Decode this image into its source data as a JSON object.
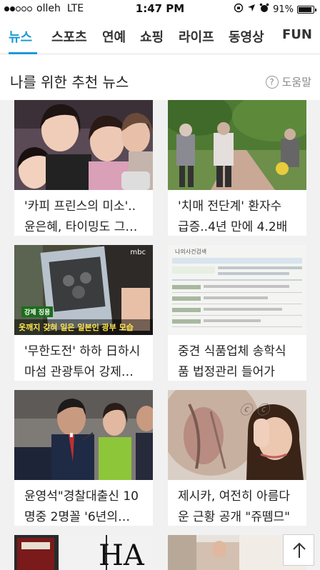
{
  "status_bar": {
    "carrier": "olleh",
    "network": "LTE",
    "time": "1:47 PM",
    "battery": "91%",
    "battery_level": 0.91,
    "signal_bars": 2,
    "signal_total": 5
  },
  "tabs": [
    {
      "label": "뉴스",
      "active": true
    },
    {
      "label": "스포츠",
      "active": false
    },
    {
      "label": "연예",
      "active": false
    },
    {
      "label": "쇼핑",
      "active": false
    },
    {
      "label": "라이프",
      "active": false
    },
    {
      "label": "동영상",
      "active": false
    },
    {
      "label": "FUN",
      "active": false
    }
  ],
  "section": {
    "title": "나를 위한 추천 뉴스",
    "help_icon": "?",
    "help_label": "도움말"
  },
  "cards": [
    {
      "line1": "'카피 프린스의 미소'..",
      "line2": "윤은혜, 타이밍도 그…"
    },
    {
      "line1": "'치매 전단계' 환자수",
      "line2": "급증..4년 만에 4.2배"
    },
    {
      "line1": "'무한도전' 하하 日하시",
      "line2": "마섬 관광투어 강제…"
    },
    {
      "line1": "중견 식품업체 송학식",
      "line2": "품 법정관리 들어가"
    },
    {
      "line1": "윤영석\"경찰대출신 10",
      "line2": "명중 2명꼴 '6년의…"
    },
    {
      "line1": "제시카, 여전히 아름다",
      "line2": "운 근황 공개 \"쥬뗌므\""
    }
  ],
  "image_overlays": {
    "mbc_logo": "mbc",
    "subtitle_small": "강제 징용",
    "subtitle_main": "옷깨지 갖혀 일은 일본인 광부 모습",
    "doc_header": "나의사건검색",
    "bottom_banner": "HA"
  },
  "colors": {
    "accent": "#1e9ad6",
    "background": "#f1f1f1"
  }
}
